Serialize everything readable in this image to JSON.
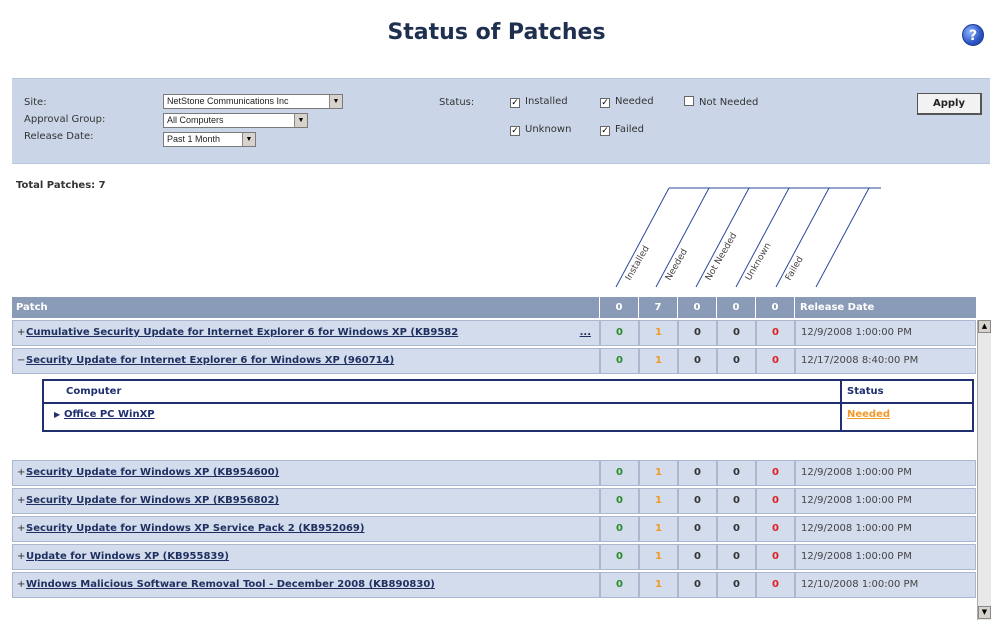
{
  "page_title": "Status of Patches",
  "help_icon": "question-icon",
  "filters": {
    "site_label": "Site:",
    "site_value": "NetStone Communications Inc",
    "group_label": "Approval Group:",
    "group_value": "All Computers",
    "date_label": "Release Date:",
    "date_value": "Past 1 Month",
    "status_label": "Status:",
    "status_options": [
      {
        "label": "Installed",
        "checked": true
      },
      {
        "label": "Needed",
        "checked": true
      },
      {
        "label": "Not Needed",
        "checked": false
      },
      {
        "label": "Unknown",
        "checked": true
      },
      {
        "label": "Failed",
        "checked": true
      }
    ],
    "apply_label": "Apply"
  },
  "total_label": "Total Patches: 7",
  "column_headers_diagonal": [
    "Installed",
    "Needed",
    "Not Needed",
    "Unknown",
    "Failed"
  ],
  "table": {
    "patch_header": "Patch",
    "count_headers": [
      "0",
      "7",
      "0",
      "0",
      "0"
    ],
    "date_header": "Release Date",
    "rows": [
      {
        "name": "Cumulative Security Update for Internet Explorer 6 for Windows XP (KB9582",
        "expander": "+",
        "more": "...",
        "counts": [
          "0",
          "1",
          "0",
          "0",
          "0"
        ],
        "date": "12/9/2008 1:00:00 PM"
      },
      {
        "name": "Security Update for Internet Explorer 6 for Windows XP (960714)",
        "expander": "−",
        "counts": [
          "0",
          "1",
          "0",
          "0",
          "0"
        ],
        "date": "12/17/2008 8:40:00 PM"
      },
      {
        "name": "Security Update for Windows XP (KB954600)",
        "expander": "+",
        "counts": [
          "0",
          "1",
          "0",
          "0",
          "0"
        ],
        "date": "12/9/2008 1:00:00 PM"
      },
      {
        "name": "Security Update for Windows XP (KB956802)",
        "expander": "+",
        "counts": [
          "0",
          "1",
          "0",
          "0",
          "0"
        ],
        "date": "12/9/2008 1:00:00 PM"
      },
      {
        "name": "Security Update for Windows XP Service Pack 2 (KB952069)",
        "expander": "+",
        "counts": [
          "0",
          "1",
          "0",
          "0",
          "0"
        ],
        "date": "12/9/2008 1:00:00 PM"
      },
      {
        "name": "Update for Windows XP (KB955839)",
        "expander": "+",
        "counts": [
          "0",
          "1",
          "0",
          "0",
          "0"
        ],
        "date": "12/9/2008 1:00:00 PM"
      },
      {
        "name": "Windows Malicious Software Removal Tool - December 2008 (KB890830)",
        "expander": "+",
        "counts": [
          "0",
          "1",
          "0",
          "0",
          "0"
        ],
        "date": "12/10/2008 1:00:00 PM"
      }
    ]
  },
  "sub_table": {
    "computer_header": "Computer",
    "status_header": "Status",
    "computer": "Office PC WinXP",
    "status": "Needed"
  },
  "colors": {
    "installed": "#2a8a2a",
    "needed": "#f09a2a",
    "failed": "#e02020",
    "header_bg": "#8a9bb8",
    "row_bg": "#d3dcec"
  }
}
